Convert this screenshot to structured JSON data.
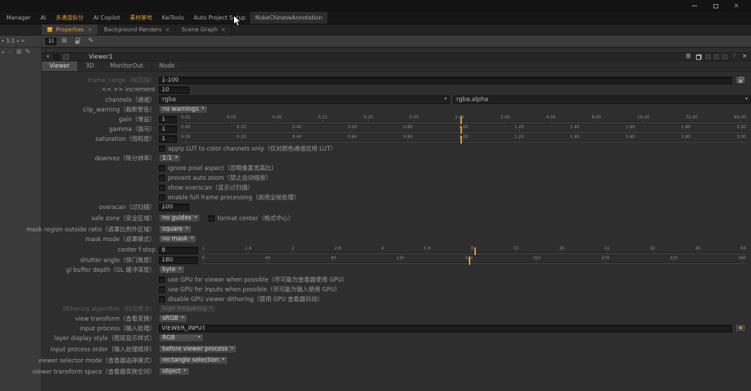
{
  "colors": {
    "accent_orange": "#dfa044",
    "slider_marker": "#eaa33c"
  },
  "icons": {
    "close": "×",
    "dropdown": "▾",
    "chevron_right": "▸",
    "chevron_up": "▴",
    "grid": "⊞",
    "pencil": "✎",
    "menu": "≡",
    "dots": "⋯",
    "help": "?",
    "center": "⊞",
    "diamond": "◆"
  },
  "menubar": {
    "items": [
      "Manager",
      "AI",
      "多通道拆分",
      "AI Copilot",
      "素材基地",
      "KeiTools",
      "Auto Project Setup",
      "NukeChineseAnnotation"
    ]
  },
  "doc_tabs": {
    "tabs": [
      {
        "label": "Properties"
      },
      {
        "label": "Background Renders"
      },
      {
        "label": "Scene Graph"
      }
    ]
  },
  "toolbar": {
    "panel_count": "10",
    "zoom": "1:1"
  },
  "panel": {
    "title": "Viewer1",
    "tabs": [
      {
        "label": "Viewer"
      },
      {
        "label": "3D"
      },
      {
        "label": "MonitorOut"
      },
      {
        "label": "Node"
      }
    ]
  },
  "rows": {
    "frame_range": {
      "label": "frame_range（帧范围）",
      "value": "1-100",
      "disabled": true
    },
    "increment": {
      "label": "<< >> increment",
      "value": "10"
    },
    "channels": {
      "label": "channels（通道）",
      "value": "rgba",
      "layer_value": "rgba.alpha"
    },
    "clip_warning": {
      "label": "clip_warning（截断警告）",
      "value": "no warnings"
    },
    "gain": {
      "label": "gain（增益）",
      "value": "1",
      "ticks": [
        "0.02",
        "0.03",
        "0.06",
        "0.13",
        "0.25",
        "0.50",
        "1.00",
        "2.00",
        "4.00",
        "8.00",
        "16.00",
        "32.00",
        "64.00"
      ]
    },
    "gamma": {
      "label": "gamma（伽马）",
      "value": "1",
      "ticks": [
        "0.00",
        "0.20",
        "0.40",
        "0.60",
        "0.80",
        "1.00",
        "1.20",
        "1.40",
        "1.60",
        "1.80",
        "2.00"
      ]
    },
    "saturation": {
      "label": "saturation（饱和度）",
      "value": "1",
      "ticks": [
        "0.00",
        "0.20",
        "0.40",
        "0.60",
        "0.80",
        "1.00",
        "1.20",
        "1.40",
        "1.60",
        "1.80",
        "2.00"
      ]
    },
    "apply_lut": {
      "label": "apply LUT to color channels only（仅对颜色通道应用 LUT）",
      "checked": false
    },
    "downrez": {
      "label": "downrez（降分辨率）",
      "value": "1:1"
    },
    "ignore_pixel_aspect": {
      "label": "ignore pixel aspect（忽略像素宽高比）",
      "checked": false
    },
    "prevent_auto_zoom": {
      "label": "prevent auto zoom（禁止自动缩放）",
      "checked": false
    },
    "show_overscan": {
      "label": "show overscan（显示过扫描）",
      "checked": false
    },
    "full_frame_processing": {
      "label": "enable full frame processing（启用全帧处理）",
      "checked": false
    },
    "overscan": {
      "label": "overscan（过扫描）",
      "value": "100"
    },
    "safe_zone": {
      "label": "safe zone（安全区域）",
      "value": "no guides",
      "format_center_label": "format center（格式中心）",
      "format_center_checked": false
    },
    "mask_region_outside_ratio": {
      "label": "mask region outside ratio（遮罩比例外区域）",
      "value": "square"
    },
    "mask_mode": {
      "label": "mask mode（遮罩模式）",
      "value": "no mask"
    },
    "center_fstop": {
      "label": "center f-stop",
      "value": "8",
      "ticks": [
        "1",
        "1.4",
        "2",
        "2.8",
        "4",
        "5.6",
        "8",
        "11",
        "16",
        "22",
        "32",
        "45",
        "64"
      ]
    },
    "shutter_angle": {
      "label": "shutter angle（快门角度）",
      "value": "180",
      "ticks": [
        "0",
        "45",
        "90",
        "135",
        "180",
        "225",
        "270",
        "315",
        "360"
      ]
    },
    "gl_buffer_depth": {
      "label": "gl buffer depth（GL 缓冲深度）",
      "value": "byte"
    },
    "gpu_viewer": {
      "label": "use GPU for viewer when possible（尽可能为查看器使用 GPU）",
      "checked": false
    },
    "gpu_inputs": {
      "label": "use GPU for inputs when possible（尽可能为输入使用 GPU）",
      "checked": false
    },
    "gpu_dithering": {
      "label": "disable GPU viewer dithering（禁用 GPU 查看器抖动）",
      "checked": false
    },
    "dithering_algorithm": {
      "label": "dithering algorithm（抖动算法）",
      "value": "high frequency",
      "disabled": true
    },
    "view_transform": {
      "label": "view transform（查看变换）",
      "value": "sRGB"
    },
    "input_process": {
      "label": "input process（输入处理）",
      "value": "VIEWER_INPUT"
    },
    "layer_display_style": {
      "label": "layer display style（图层显示样式）",
      "value": "RGB"
    },
    "input_process_order": {
      "label": "input process order（输入处理顺序）",
      "value": "before viewer process"
    },
    "viewer_selector_mode": {
      "label": "viewer selector mode（查看器选择模式）",
      "value": "rectangle selection"
    },
    "viewer_transform_space": {
      "label": "viewer transform space（查看器变换空间）",
      "value": "object"
    }
  }
}
